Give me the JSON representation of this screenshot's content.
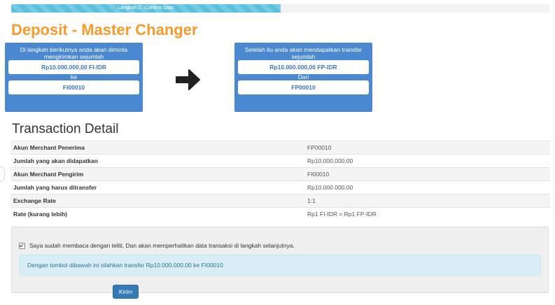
{
  "progress": {
    "label": "Langkah 2 : Confirm Data",
    "percent": 50
  },
  "page_title": "Deposit - Master Changer",
  "send_box": {
    "message": "Di langkah berikutnya anda akan diminta mengirimkan sejumlah",
    "amount": "Rp10.000.000,00 FI-IDR",
    "separator": "ke",
    "account": "FI00010"
  },
  "receive_box": {
    "message": "Setelah itu anda akan mendapatkan transfer sejumlah",
    "amount": "Rp10.000.000,00 FP-IDR",
    "separator": "Dari",
    "account": "FP00010"
  },
  "icons": {
    "arrow": "arrow-right-icon",
    "check": "checkbox-checked-icon"
  },
  "colors": {
    "accent": "#f79a2b",
    "box": "#4a89d0",
    "progress": "#5bc0de",
    "button": "#337ab7"
  },
  "transaction_detail": {
    "title": "Transaction Detail",
    "rows": [
      {
        "label": "Akun Merchant Penerima",
        "value": "FP00010"
      },
      {
        "label": "Jumlah yang akan didapatkan",
        "value": "Rp10.000.000,00"
      },
      {
        "label": "Akun Merchant Pengirim",
        "value": "FI00010"
      },
      {
        "label": "Jumlah yang harus ditransfer",
        "value": "Rp10.000.000,00"
      },
      {
        "label": "Exchange Rate",
        "value": "1:1"
      },
      {
        "label": "Rate (kurang lebih)",
        "value": "Rp1 FI-IDR = Rp1 FP-IDR"
      }
    ]
  },
  "agreement": {
    "checked": true,
    "text": "Saya sudah membaca dengan teliti, Dan akan memperhatikan data transaksi di langkah selanjutnya."
  },
  "info_message": "Dengan tombol dibawah ini silahkan transfer Rp10.000.000,00 ke FI00010",
  "submit_label": "Kirim"
}
